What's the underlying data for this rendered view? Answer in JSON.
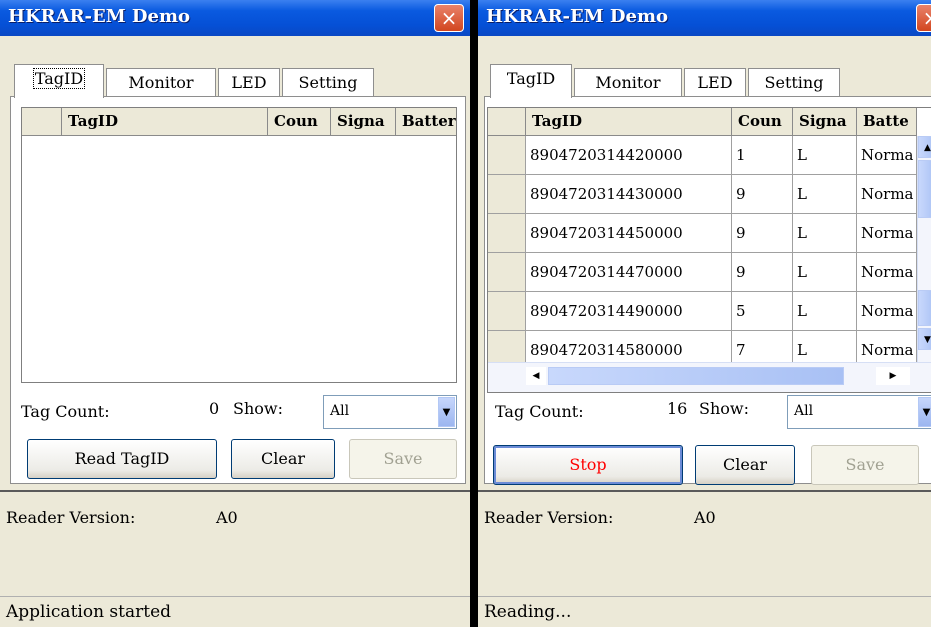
{
  "windows": [
    {
      "title": "HKRAR-EM Demo",
      "close_icon": "×",
      "tabs": [
        "TagID",
        "Monitor",
        "LED",
        "Setting"
      ],
      "active_tab": "TagID",
      "table": {
        "columns": [
          "TagID",
          "Coun",
          "Signa",
          "Batter"
        ],
        "rows": []
      },
      "tag_count_label": "Tag Count:",
      "tag_count_value": "0",
      "show_label": "Show:",
      "show_value": "All",
      "buttons": {
        "primary": "Read TagID",
        "clear": "Clear",
        "save": "Save"
      },
      "reader_version_label": "Reader Version:",
      "reader_version_value": "A0",
      "status": "Application started"
    },
    {
      "title": "HKRAR-EM Demo",
      "close_icon": "×",
      "tabs": [
        "TagID",
        "Monitor",
        "LED",
        "Setting"
      ],
      "active_tab": "TagID",
      "table": {
        "columns": [
          "TagID",
          "Coun",
          "Signa",
          "Batte"
        ],
        "rows": [
          {
            "tagid": "8904720314420000",
            "count": "1",
            "signal": "L",
            "battery": "Norma"
          },
          {
            "tagid": "8904720314430000",
            "count": "9",
            "signal": "L",
            "battery": "Norma"
          },
          {
            "tagid": "8904720314450000",
            "count": "9",
            "signal": "L",
            "battery": "Norma"
          },
          {
            "tagid": "8904720314470000",
            "count": "9",
            "signal": "L",
            "battery": "Norma"
          },
          {
            "tagid": "8904720314490000",
            "count": "5",
            "signal": "L",
            "battery": "Norma"
          },
          {
            "tagid": "8904720314580000",
            "count": "7",
            "signal": "L",
            "battery": "Norma"
          }
        ]
      },
      "tag_count_label": "Tag Count:",
      "tag_count_value": "16",
      "show_label": "Show:",
      "show_value": "All",
      "buttons": {
        "primary": "Stop",
        "clear": "Clear",
        "save": "Save"
      },
      "reader_version_label": "Reader Version:",
      "reader_version_value": "A0",
      "status": "Reading..."
    }
  ],
  "icons": {
    "close": "close-icon",
    "combo_arrow": "chevron-down-icon",
    "scroll_up": "arrow-up-icon",
    "scroll_down": "arrow-down-icon",
    "scroll_left": "arrow-left-icon",
    "scroll_right": "arrow-right-icon"
  },
  "colors": {
    "titlebar": "#0550d6",
    "close_button": "#d2461f",
    "stop_text": "#ff0000",
    "face": "#ece9d8"
  }
}
